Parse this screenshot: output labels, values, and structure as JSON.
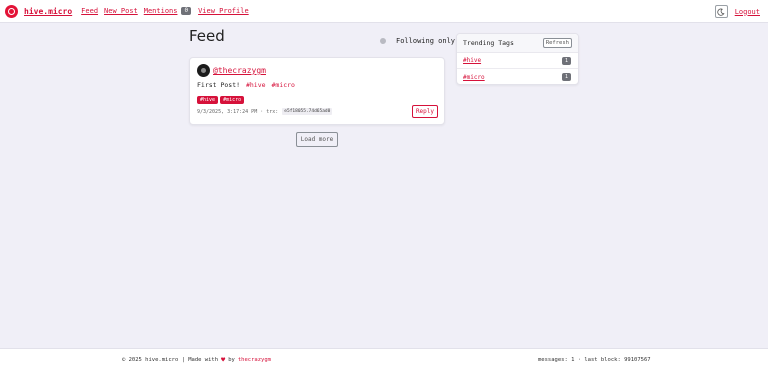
{
  "header": {
    "brand": "hive.micro",
    "nav": [
      {
        "label": "Feed"
      },
      {
        "label": "New Post"
      },
      {
        "label": "Mentions",
        "badge": "0"
      },
      {
        "label": "View Profile"
      }
    ],
    "logout_label": "Logout"
  },
  "main": {
    "title": "Feed",
    "following_toggle_label": "Following only",
    "load_more_label": "Load more"
  },
  "post": {
    "author": "@thecrazygm",
    "text": "First Post!",
    "inline_tags": [
      "#hive",
      "#micro"
    ],
    "tags": [
      "#hive",
      "#micro"
    ],
    "timestamp": "9/3/2025, 3:17:24 PM",
    "trx_label": "trx:",
    "trx_id": "e5f18055.74d65ad0",
    "reply_label": "Reply"
  },
  "trending": {
    "title": "Trending Tags",
    "refresh_label": "Refresh",
    "tags": [
      {
        "tag": "#hive",
        "count": "1"
      },
      {
        "tag": "#micro",
        "count": "1"
      }
    ]
  },
  "footer": {
    "left_text": "© 2025 hive.micro | Made with",
    "by_text": "by",
    "author_link": "thecrazygm",
    "right_text": "messages: 1 · last block: 99107567"
  },
  "colors": {
    "accent": "#d6113a",
    "brand_logo": "#e31337",
    "background": "#f0eff7"
  },
  "icons": {
    "logo": "hive-logo-icon",
    "theme_toggle": "theme-toggle-icon",
    "heart": "heart-icon"
  }
}
